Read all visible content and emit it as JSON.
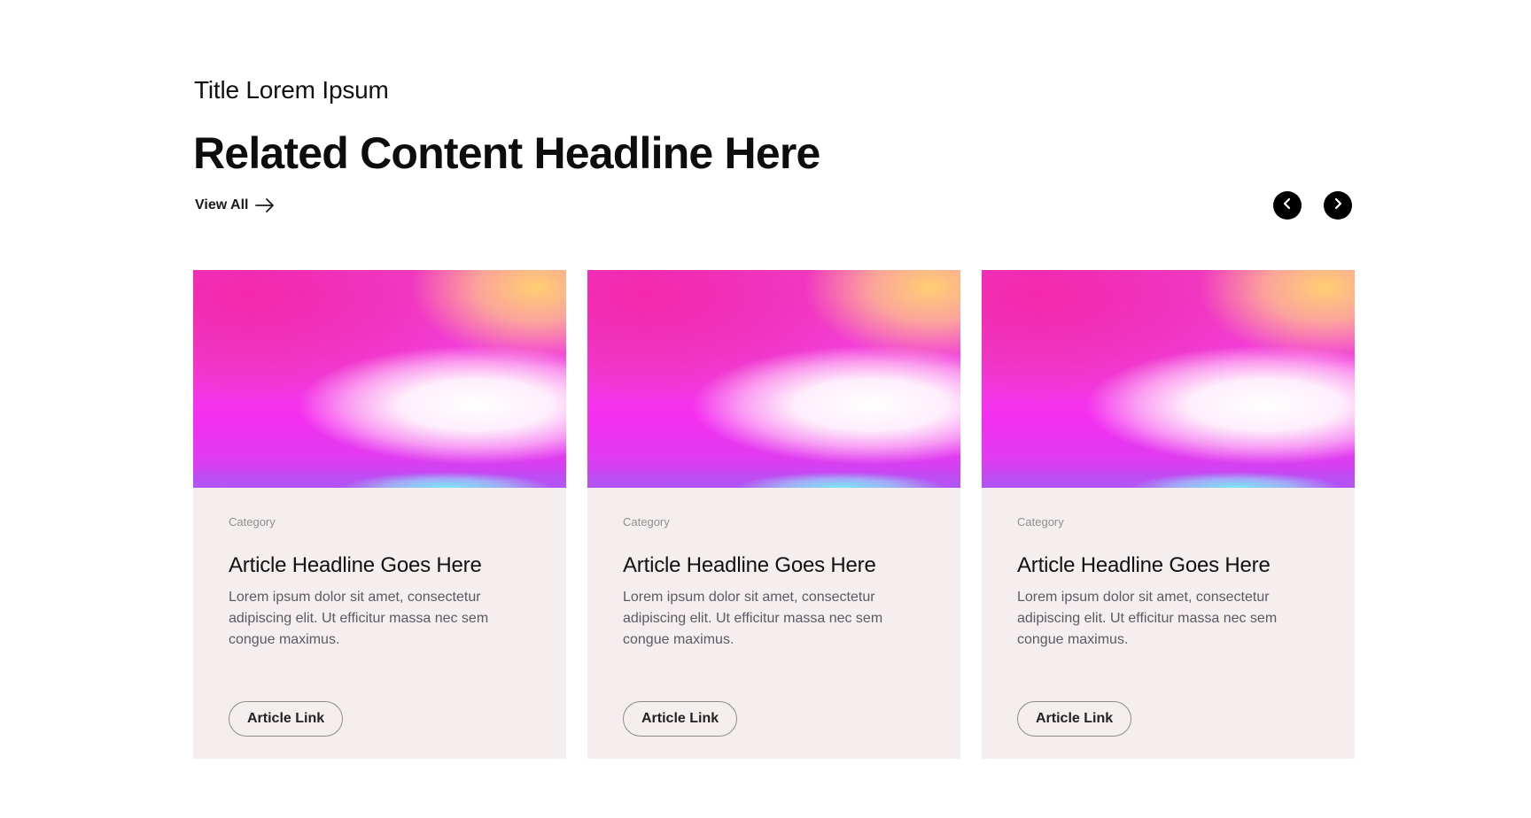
{
  "section": {
    "eyebrow": "Title Lorem Ipsum",
    "headline": "Related Content Headline Here",
    "view_all_label": "View All",
    "view_all_icon": "arrow-right-icon",
    "prev_icon": "chevron-left-icon",
    "next_icon": "chevron-right-icon"
  },
  "cards": [
    {
      "category": "Category",
      "title": "Article Headline Goes Here",
      "description": "Lorem ipsum dolor sit amet, consectetur adipiscing elit. Ut efficitur massa nec sem congue maximus.",
      "link_label": "Article Link"
    },
    {
      "category": "Category",
      "title": "Article Headline Goes Here",
      "description": "Lorem ipsum dolor sit amet, consectetur adipiscing elit. Ut efficitur massa nec sem congue maximus.",
      "link_label": "Article Link"
    },
    {
      "category": "Category",
      "title": "Article Headline Goes Here",
      "description": "Lorem ipsum dolor sit amet, consectetur adipiscing elit. Ut efficitur massa nec sem congue maximus.",
      "link_label": "Article Link"
    }
  ],
  "colors": {
    "card_background": "#f5eeee",
    "nav_button": "#000000",
    "text_primary": "#111111",
    "text_muted": "#8f8f8f",
    "text_body": "#5a5a64"
  }
}
